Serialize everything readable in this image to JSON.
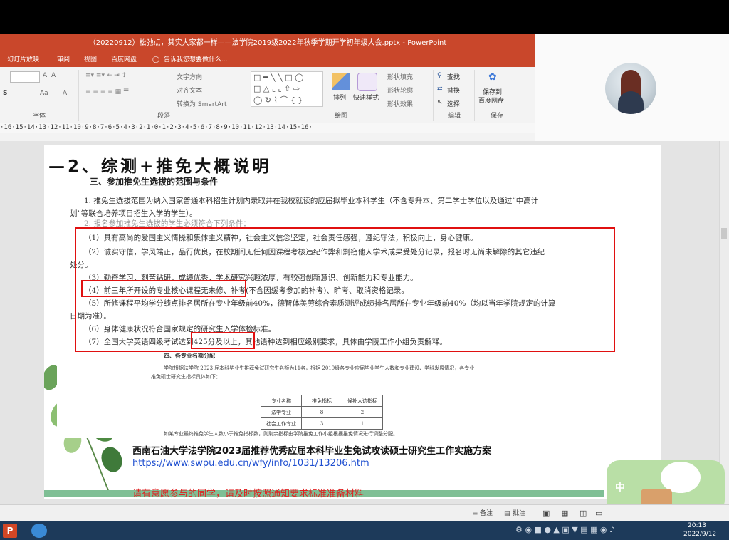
{
  "window": {
    "title": "（20220912）松弛点，其实大家都一样——法学院2019级2022年秋季学期开学初年级大会.pptx - PowerPoint"
  },
  "ribbon_tabs": [
    "幻灯片放映",
    "审阅",
    "视图",
    "百度网盘"
  ],
  "tell_me": "告诉我您想要做什么...",
  "ribbon": {
    "font_group_label": "字体",
    "paragraph_group_label": "段落",
    "drawing_group_label": "绘图",
    "editing_group_label": "编辑",
    "save_group_label": "保存",
    "text_direction": "文字方向",
    "align_text": "对齐文本",
    "convert_smartart": "转换为 SmartArt",
    "arrange": "排列",
    "quick_styles": "快速样式",
    "shape_fill": "形状填充",
    "shape_outline": "形状轮廓",
    "shape_effects": "形状效果",
    "find": "查找",
    "replace": "替换",
    "select": "选择",
    "save_to_baidu_line1": "保存到",
    "save_to_baidu_line2": "百度网盘",
    "font_size_value": "",
    "font_small_labels": [
      "A",
      "A",
      "Aa",
      "A"
    ]
  },
  "ruler_text": "·16·15·14·13·12·11·10·9·8·7·6·5·4·3·2·1·0·1·2·3·4·5·6·7·8·9·10·11·12·13·14·15·16·",
  "slide": {
    "heading": "—2、综测+推免大概说明",
    "section3_title": "三、参加推免生选拔的范围与条件",
    "item1_line1": "1. 推免生选拔范围为纳入国家普通本科招生计划内录取并在我校就读的应届拟毕业本科学生（不含专升本、第二学士学位以及通过“中高计",
    "item1_line2": "划”等联合培养项目招生入学的学生）。",
    "item2": "2. 报名参加推免生选拔的学生必须符合下列条件：",
    "cond1": "（1）具有高尚的爱国主义情操和集体主义精神，社会主义信念坚定，社会责任感强，遵纪守法，积极向上，身心健康。",
    "cond2_line1": "（2）诚实守信，学风端正，品行优良，在校期间无任何因课程考核违纪作弊和剽窃他人学术成果受处分记录，报名时无尚未解除的其它违纪",
    "cond2_line2": "处分。",
    "cond3": "（3）勤奋学习，刻苦钻研，成绩优秀，学术研究兴趣浓厚，有较强创新意识、创新能力和专业能力。",
    "cond4": "（4）前三年所开设的专业核心课程无未修、补考(不含因缓考参加的补考)、旷考、取消资格记录。",
    "cond5_line1": "（5）所修课程平均学分绩点排名居所在专业年级前40%，德智体美劳综合素质测评成绩排名居所在专业年级前40%（均以当年学院规定的计算",
    "cond5_line2": "日期为准）。",
    "cond6": "（6）身体健康状况符合国家规定的研究生入学体检标准。",
    "cond7": "（7）全国大学英语四级考试达到425分及以上，其他语种达到相应级别要求，具体由学院工作小组负责解释。",
    "section4_title": "四、各专业名额分配",
    "sec4_para_line1": "学院根据法学院 2023 届本科毕业生推荐免试研究生名额为11名，根据 2019级各专业应届毕业学生人数和专业建设、学科发展情况，各专业",
    "sec4_para_line2": "推免硕士研究生指标具体如下：",
    "table_headers": [
      "专业名称",
      "推免指标",
      "候补人选指标"
    ],
    "table_rows": [
      [
        "法学专业",
        "8",
        "2"
      ],
      [
        "社会工作专业",
        "3",
        "1"
      ]
    ],
    "sec4_footnote": "如某专业最终推免学生人数小于推免指标数，则剩余指标由学院推免工作小组根据推免情况进行调整分配。",
    "caption": "西南石油大学法学院2023届推荐优秀应届本科毕业生免试攻读硕士研究生工作实施方案",
    "link": "https://www.swpu.edu.cn/wfy/info/1031/13206.htm",
    "notice": "请有意愿参与的同学，请及时按照通知要求标准准备材料"
  },
  "statusbar": {
    "notes": "备注",
    "comments": "批注"
  },
  "sticker_text": "中",
  "taskbar": {
    "time": "20:13",
    "date": "2022/9/12"
  },
  "colors": {
    "ppt_brand": "#c9472b",
    "highlight_red": "#e01010",
    "link_blue": "#1f4fd0",
    "bar_green": "#7fbf95"
  }
}
